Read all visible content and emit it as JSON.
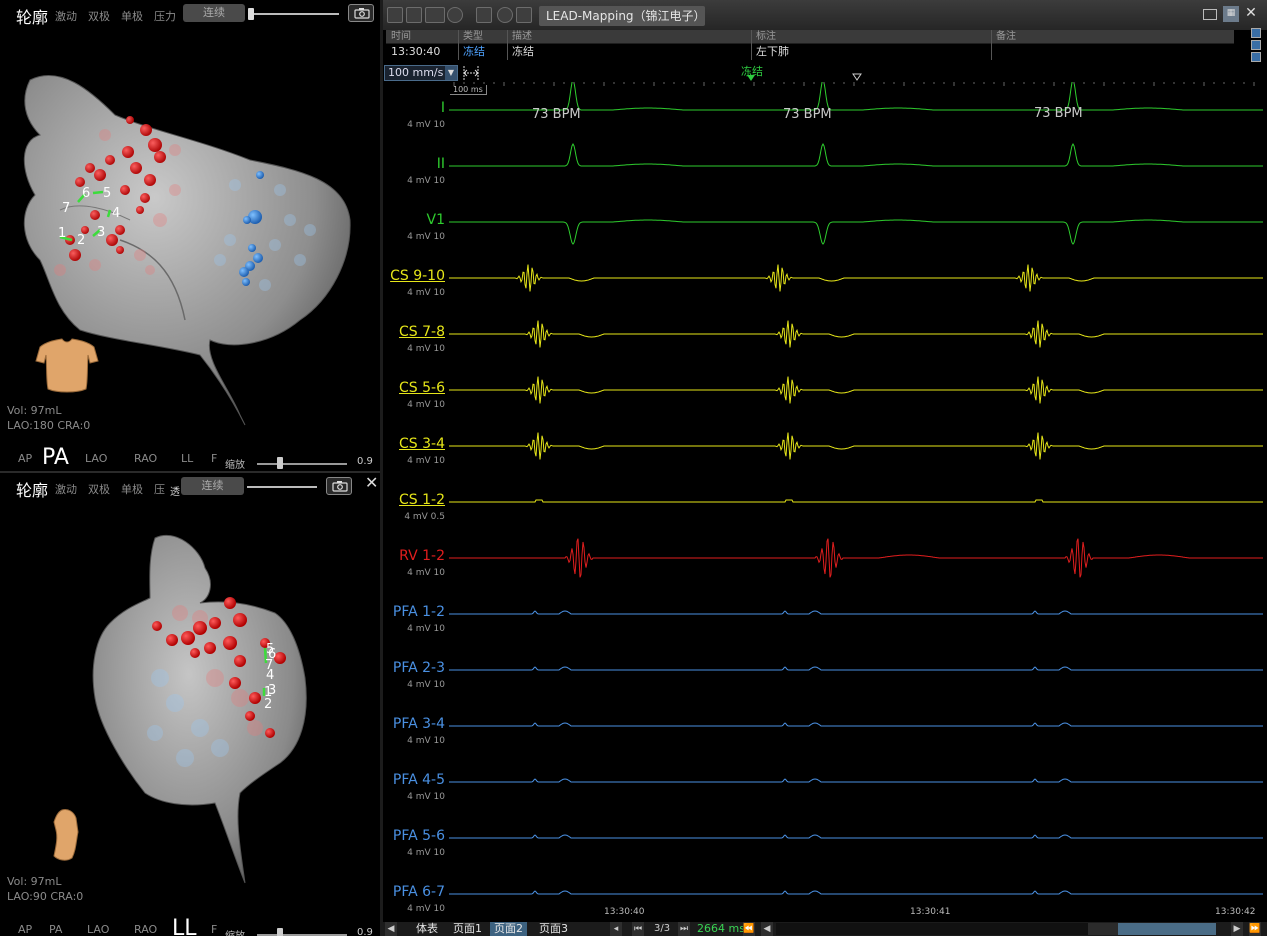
{
  "top_view": {
    "title": "轮廓",
    "tabs": [
      "激动",
      "双极",
      "单极",
      "压力"
    ],
    "mode_button": "连续",
    "info_volume": "Vol: 97mL",
    "info_angle": "LAO:180 CRA:0",
    "views": [
      "AP",
      "PA",
      "LAO",
      "RAO",
      "LL",
      "F"
    ],
    "active_view": "PA",
    "zoom_label": "缩放",
    "zoom_value": "0.9",
    "electrode_labels": [
      "1",
      "2",
      "3",
      "4",
      "5",
      "6",
      "7"
    ]
  },
  "bottom_view": {
    "title": "轮廓",
    "tabs": [
      "激动",
      "双极",
      "单极",
      "压"
    ],
    "tab_extra": "透",
    "mode_button": "连续",
    "info_volume": "Vol: 97mL",
    "info_angle": "LAO:90 CRA:0",
    "views": [
      "AP",
      "PA",
      "LAO",
      "RAO"
    ],
    "active_view": "LL",
    "view_extra": "F",
    "zoom_label": "缩放",
    "zoom_value": "0.9",
    "electrode_labels": [
      "5",
      "6",
      "7",
      "4",
      "3",
      "1",
      "2"
    ]
  },
  "window": {
    "title": "LEAD-Mapping（锦江电子）",
    "event_table": {
      "headers": [
        "时间",
        "类型",
        "描述",
        "标注",
        "备注"
      ],
      "row": [
        "13:30:40",
        "冻结",
        "冻结",
        "左下肺",
        ""
      ]
    },
    "speed": "100 mm/s",
    "freeze_marker": "冻结",
    "scale_label": "100 ms",
    "bpm_labels": [
      "73 BPM",
      "73 BPM",
      "73 BPM"
    ],
    "time_labels": [
      "13:30:40",
      "13:30:41",
      "13:30:42"
    ],
    "channels": [
      {
        "name": "I",
        "scale": "4 mV 10",
        "color": "#2ecc2e"
      },
      {
        "name": "II",
        "scale": "4 mV 10",
        "color": "#2ecc2e"
      },
      {
        "name": "V1",
        "scale": "4 mV 10",
        "color": "#2ecc2e"
      },
      {
        "name": "CS 9-10",
        "scale": "4 mV 10",
        "color": "#e6e619"
      },
      {
        "name": "CS 7-8",
        "scale": "4 mV 10",
        "color": "#e6e619"
      },
      {
        "name": "CS 5-6",
        "scale": "4 mV 10",
        "color": "#e6e619"
      },
      {
        "name": "CS 3-4",
        "scale": "4 mV 10",
        "color": "#e6e619"
      },
      {
        "name": "CS 1-2",
        "scale": "4 mV 0.5",
        "color": "#e6e619"
      },
      {
        "name": "RV 1-2",
        "scale": "4 mV 10",
        "color": "#e01e1e"
      },
      {
        "name": "PFA 1-2",
        "scale": "4 mV 10",
        "color": "#4a90e2"
      },
      {
        "name": "PFA 2-3",
        "scale": "4 mV 10",
        "color": "#4a90e2"
      },
      {
        "name": "PFA 3-4",
        "scale": "4 mV 10",
        "color": "#4a90e2"
      },
      {
        "name": "PFA 4-5",
        "scale": "4 mV 10",
        "color": "#4a90e2"
      },
      {
        "name": "PFA 5-6",
        "scale": "4 mV 10",
        "color": "#4a90e2"
      },
      {
        "name": "PFA 6-7",
        "scale": "4 mV 10",
        "color": "#4a90e2"
      }
    ],
    "status": {
      "tabs": [
        "体表",
        "页面1",
        "页面2",
        "页面3"
      ],
      "active_tab": "页面2",
      "page": "3/3",
      "duration": "2664 ms"
    }
  }
}
